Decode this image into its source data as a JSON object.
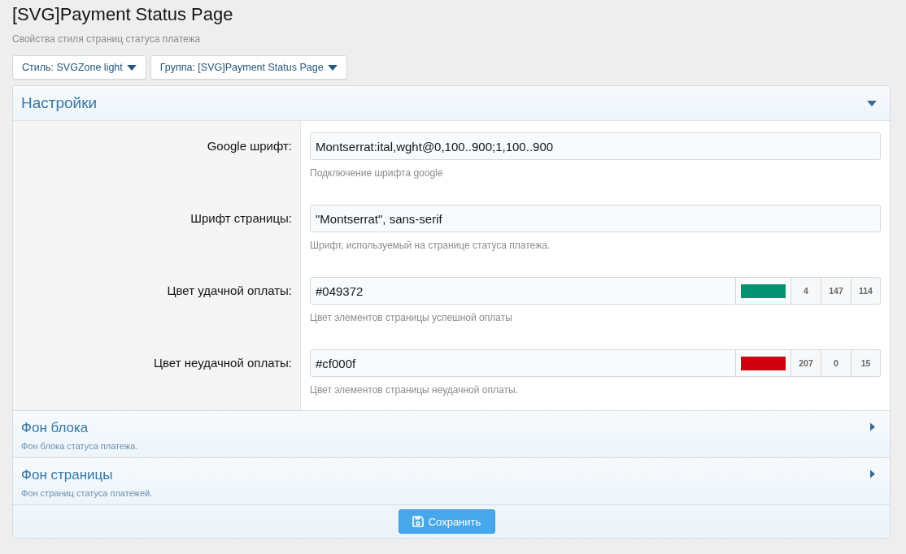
{
  "page": {
    "title": "[SVG]Payment Status Page",
    "description": "Свойства стиля страниц статуса платежа"
  },
  "filters": [
    {
      "label": "Стиль: SVGZone light"
    },
    {
      "label": "Группа: [SVG]Payment Status Page"
    }
  ],
  "sections": [
    {
      "title": "Настройки",
      "expanded": true,
      "fields": [
        {
          "kind": "text",
          "label": "Google шрифт:",
          "value": "Montserrat:ital,wght@0,100..900;1,100..900",
          "hint": "Подключение шрифта google"
        },
        {
          "kind": "text",
          "label": "Шрифт страницы:",
          "value": "\"Montserrat\", sans-serif",
          "hint": "Шрифт, используемый на странице статуса платежа."
        },
        {
          "kind": "color",
          "label": "Цвет удачной оплаты:",
          "value": "#049372",
          "color": "#049372",
          "rgb": [
            "4",
            "147",
            "114"
          ],
          "hint": "Цвет элементов страницы успешной оплаты"
        },
        {
          "kind": "color",
          "label": "Цвет неудачной оплаты:",
          "value": "#cf000f",
          "color": "#cf000f",
          "rgb": [
            "207",
            "0",
            "15"
          ],
          "hint": "Цвет элементов страницы неудачной оплаты."
        }
      ]
    },
    {
      "title": "Фон блока",
      "description": "Фон блока статуса платежа.",
      "expanded": false
    },
    {
      "title": "Фон страницы",
      "description": "Фон страниц статуса платежей.",
      "expanded": false
    }
  ],
  "save_button": {
    "label": "Сохранить"
  }
}
